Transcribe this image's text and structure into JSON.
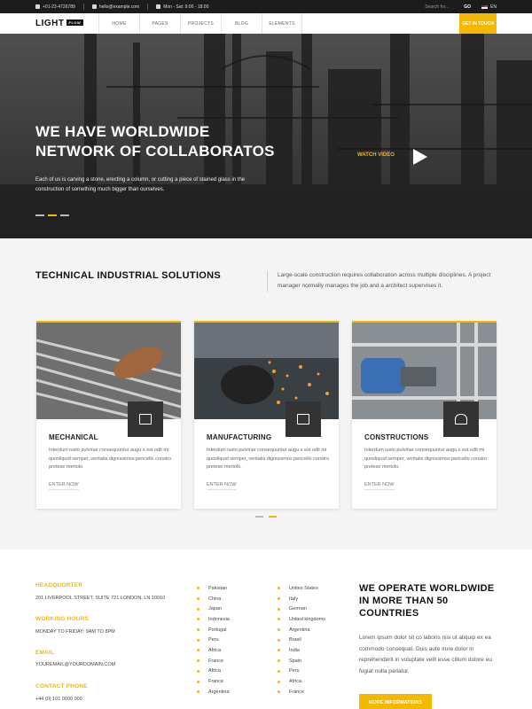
{
  "topbar": {
    "phone": "+01-23-4726789",
    "email": "hello@example.com",
    "hours": "Mon - Sat: 9:00 - 18:00",
    "search_placeholder": "Search for...",
    "go_label": "GO",
    "language": "EN"
  },
  "nav": {
    "logo": "LIGHT",
    "logo_badge": "FLOW",
    "items": [
      "HOME",
      "PAGES",
      "PROJECTS",
      "BLOG",
      "ELEMENTS"
    ],
    "cta": "GET IN TOUCH"
  },
  "hero": {
    "title_line1": "WE HAVE WORLDWIDE",
    "title_line2": "NETWORK OF COLLABORATOS",
    "text": "Each of us is carving a stone, erecting a column, or cutting a piece of stained glass in the construction of something much bigger than ourselves.",
    "watch_label": "WATCH VIDEO"
  },
  "services": {
    "title": "TECHNICAL INDUSTRIAL SOLUTIONS",
    "description": "Large-scale construction requires collaboration across multiple disciplines. A project manager normally manages the job and a architect supervises it.",
    "cards": [
      {
        "title": "MECHANICAL",
        "text": "Interdum iusto pulvinar consequuntur augu s est odit mi quosliquid semper, veritatis dignissimos pericello constro pretese mertolo.",
        "link": "ENTER NOW",
        "icon": "tools-icon"
      },
      {
        "title": "MANUFACTURING",
        "text": "Interdum iusto pulvinar consequuntur augu s est odit mi quosliquid semper, veritatis dignissimos pericello constro pretese mertolo.",
        "link": "ENTER NOW",
        "icon": "briefcase-icon"
      },
      {
        "title": "CONSTRUCTIONS",
        "text": "Interdum iusto pulvinar consequuntur augu s est odit mi quosliquid semper, veritatis dignissimos pericello constro pretese mertolo.",
        "link": "ENTER NOW",
        "icon": "worker-icon"
      }
    ]
  },
  "contact": {
    "hq_label": "HEADQUORTER",
    "hq_value": "201 LIVERPOOL STREET, SUITE 721 LONDON, LN 10010",
    "hours_label": "WORKING HOURS",
    "hours_value": "MONDAY TO FRIDAY: 9AM TO 8PM",
    "email_label": "EMAIL",
    "email_value": "YOUREMAIL@YOURDOMAIN.COM",
    "phone_label": "CONTACT PHONE",
    "phone_value": "+44 (0) 101 0000 000"
  },
  "countries_col1": [
    "Pakistan",
    "China",
    "Japan",
    "Indonesia",
    "Portugal",
    "Peru",
    "Africa",
    "France",
    "Africa",
    "France",
    "Argentina"
  ],
  "countries_col2": [
    "Unites States",
    "Italy",
    "German",
    "United kingdoms",
    "Argentina",
    "Brasil",
    "India",
    "Spain",
    "Peru",
    "Africa",
    "France"
  ],
  "operate": {
    "title": "WE OPERATE WORLDWIDE IN MORE THAN 50 COUNTRIES",
    "text": "Lorem ipsum dolor sit co laboris nisi ut aliquip ex ea commodo consequat. Duis aute irure dolor in reprehenderit in voluptate velit esse cillum dolore eu fugiat nulla pariatur.",
    "button": "MORE INFORMATIONS"
  },
  "colors": {
    "accent": "#f5b800",
    "dark": "#1c1c1c"
  }
}
